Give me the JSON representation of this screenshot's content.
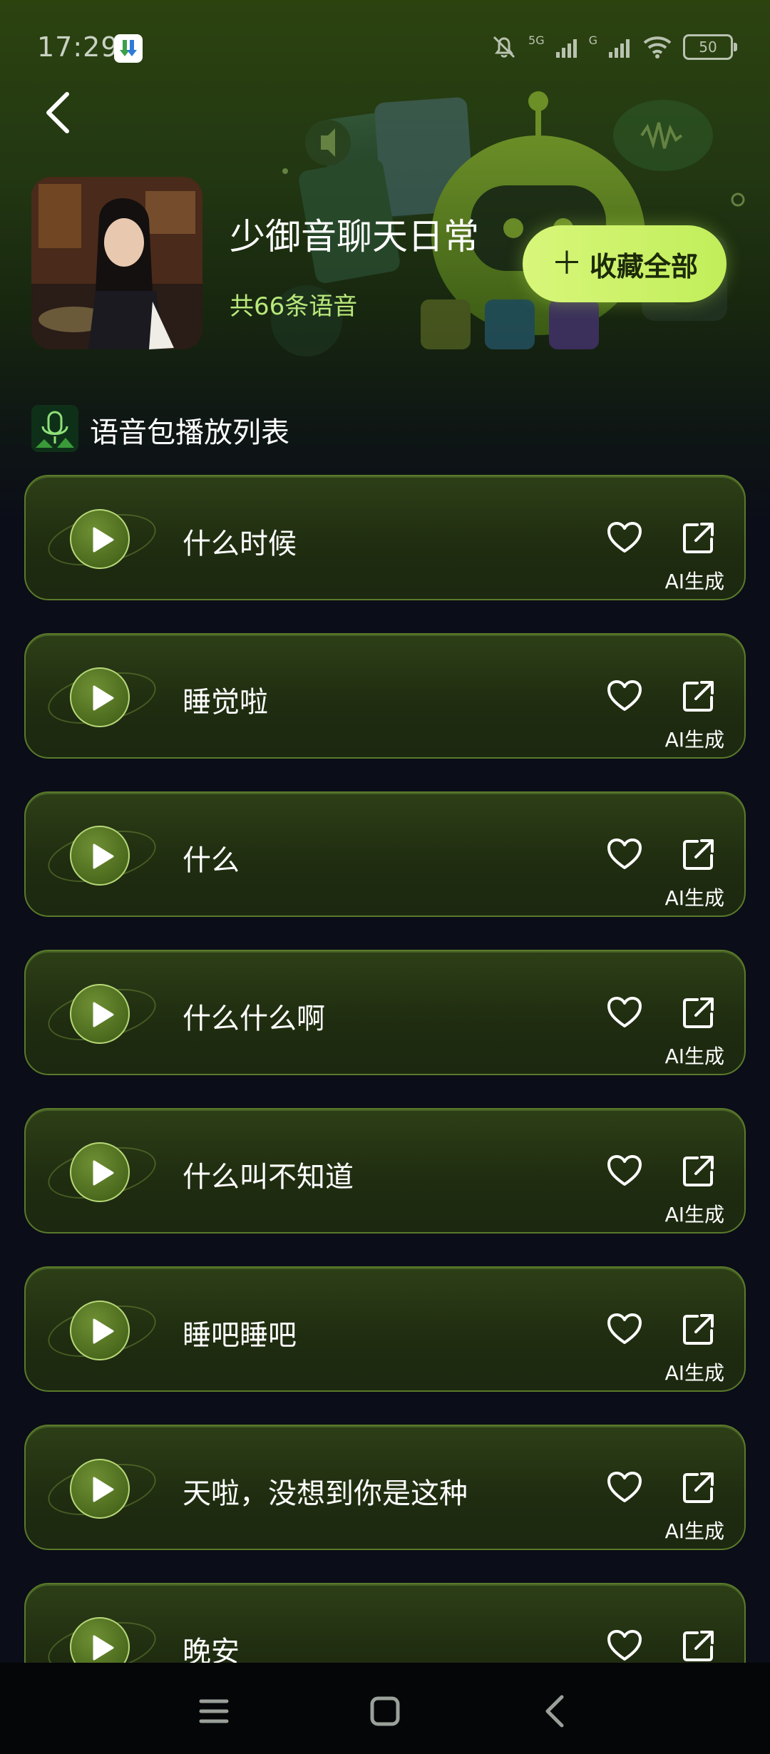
{
  "status_bar": {
    "time": "17:29",
    "battery": "50",
    "signal_labels": [
      "5G",
      "G"
    ],
    "icons": [
      "app-download-icon",
      "mute-icon",
      "signal-5g-icon",
      "signal-icon",
      "wifi-icon",
      "battery-icon"
    ]
  },
  "header": {
    "title": "少御音聊天日常",
    "count": "共66条语音",
    "collect_all_label": "收藏全部"
  },
  "section": {
    "title": "语音包播放列表"
  },
  "voices": [
    {
      "title": "什么时候",
      "tag": "AI生成"
    },
    {
      "title": "睡觉啦",
      "tag": "AI生成"
    },
    {
      "title": "什么",
      "tag": "AI生成"
    },
    {
      "title": "什么什么啊",
      "tag": "AI生成"
    },
    {
      "title": "什么叫不知道",
      "tag": "AI生成"
    },
    {
      "title": "睡吧睡吧",
      "tag": "AI生成"
    },
    {
      "title": "天啦，没想到你是这种",
      "tag": "AI生成"
    },
    {
      "title": "晚安",
      "tag": ""
    }
  ],
  "colors": {
    "accent": "#c7f060",
    "count_text": "#b9e87b",
    "card_border": "#5a7a2a",
    "background": "#0b0d18"
  }
}
